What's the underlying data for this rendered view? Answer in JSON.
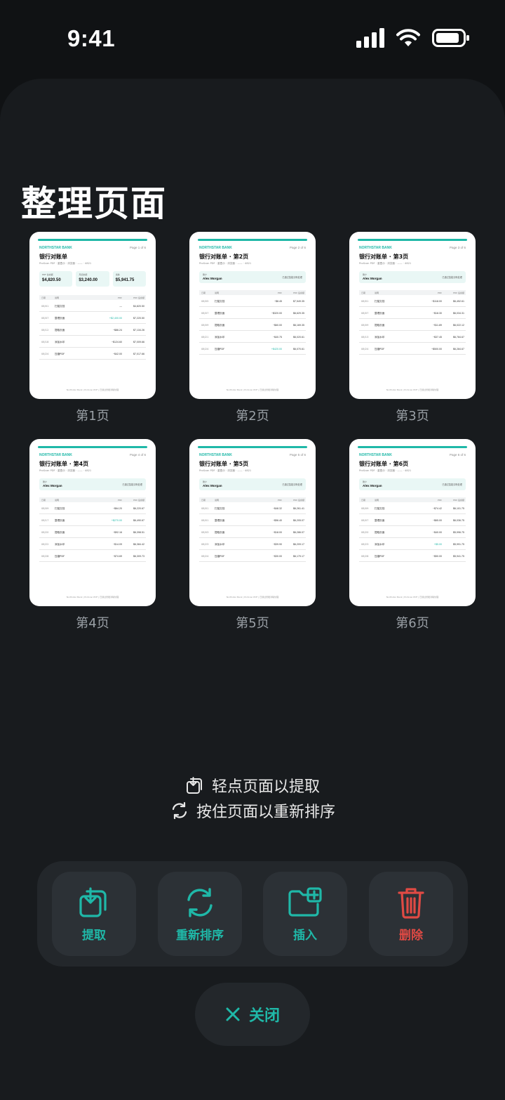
{
  "status": {
    "time": "9:41"
  },
  "title": "整理页面",
  "doc_common": {
    "bank": "NORTHSTAR BANK",
    "subtitle": "ProScan PDF · 重叠示 · 浏览器 · —— · 4821",
    "account_label": "账户",
    "account_name": "Alex Morgan",
    "account_note": "已通过智能清晰处理",
    "head_date": "日期",
    "head_desc": "说明",
    "head_amt": "PDF",
    "head_bal": "PDF 后余额",
    "footer": "Northstar Bank | ProScan PDF | 已通过智能清晰处理",
    "stat_labels": [
      "PDF 总余额",
      "月初余额",
      "当前"
    ]
  },
  "pages": [
    {
      "label": "第1页",
      "pageof": "Page 1 of 6",
      "doc_title": "银行对账单",
      "stats": [
        "$4,820.50",
        "$3,240.00",
        "$5,941.75"
      ],
      "rows": [
        {
          "d": "08/01",
          "t": "扫描文档",
          "a": "—",
          "b": "$4,820.50",
          "pos": false
        },
        {
          "d": "08/07",
          "t": "整理页面",
          "a": "+$2,400.00",
          "b": "$7,220.50",
          "pos": true
        },
        {
          "d": "08/12",
          "t": "提取页面",
          "a": "−$86.24",
          "b": "$7,134.26",
          "pos": false
        },
        {
          "d": "08/18",
          "t": "添加水印",
          "a": "−$124.60",
          "b": "$7,009.66",
          "pos": false
        },
        {
          "d": "08/24",
          "t": "压缩PDF",
          "a": "−$42.00",
          "b": "$7,017.66",
          "pos": false
        }
      ]
    },
    {
      "label": "第2页",
      "pageof": "Page 2 of 6",
      "doc_title": "银行对账单 · 第2页",
      "rows": [
        {
          "d": "08/05",
          "t": "扫描文档",
          "a": "−$8.45",
          "b": "$7,549.35",
          "pos": false
        },
        {
          "d": "08/07",
          "t": "整理页面",
          "a": "−$320.00",
          "b": "$6,629.35",
          "pos": false
        },
        {
          "d": "08/09",
          "t": "提取页面",
          "a": "−$60.00",
          "b": "$6,169.35",
          "pos": false
        },
        {
          "d": "08/21",
          "t": "添加水印",
          "a": "−$40.75",
          "b": "$6,020.61",
          "pos": false
        },
        {
          "d": "08/24",
          "t": "压缩PDF",
          "a": "+$420.00",
          "b": "$6,070.61",
          "pos": true
        }
      ]
    },
    {
      "label": "第3页",
      "pageof": "Page 3 of 6",
      "doc_title": "银行对账单 · 第3页",
      "rows": [
        {
          "d": "08/01",
          "t": "扫描文档",
          "a": "−$118.00",
          "b": "$6,452.61",
          "pos": false
        },
        {
          "d": "08/07",
          "t": "整理页面",
          "a": "−$18.30",
          "b": "$6,034.31",
          "pos": false
        },
        {
          "d": "08/09",
          "t": "提取页面",
          "a": "−$11.89",
          "b": "$6,022.12",
          "pos": false
        },
        {
          "d": "08/13",
          "t": "添加水印",
          "a": "−$37.45",
          "b": "$6,784.67",
          "pos": false
        },
        {
          "d": "08/24",
          "t": "压缩PDF",
          "a": "−$500.00",
          "b": "$6,284.67",
          "pos": false
        }
      ]
    },
    {
      "label": "第4页",
      "pageof": "Page 4 of 6",
      "doc_title": "银行对账单 · 第4页",
      "rows": [
        {
          "d": "08/09",
          "t": "扫描文档",
          "a": "−$64.20",
          "b": "$6,220.67",
          "pos": false
        },
        {
          "d": "08/17",
          "t": "整理页面",
          "a": "+$270.00",
          "b": "$6,490.67",
          "pos": true
        },
        {
          "d": "08/20",
          "t": "提取页面",
          "a": "−$92.16",
          "b": "$6,398.51",
          "pos": false
        },
        {
          "d": "08/22",
          "t": "添加水印",
          "a": "−$14.09",
          "b": "$6,384.42",
          "pos": false
        },
        {
          "d": "08/28",
          "t": "压缩PDF",
          "a": "−$74.69",
          "b": "$6,309.73",
          "pos": false
        }
      ]
    },
    {
      "label": "第5页",
      "pageof": "Page 5 of 6",
      "doc_title": "银行对账单 · 第5页",
      "rows": [
        {
          "d": "08/01",
          "t": "扫描文档",
          "a": "−$48.32",
          "b": "$6,261.41",
          "pos": false
        },
        {
          "d": "08/01",
          "t": "整理页面",
          "a": "−$56.40",
          "b": "$6,205.07",
          "pos": false
        },
        {
          "d": "08/03",
          "t": "提取页面",
          "a": "−$18.00",
          "b": "$6,286.07",
          "pos": false
        },
        {
          "d": "08/23",
          "t": "添加水印",
          "a": "−$39.90",
          "b": "$6,209.17",
          "pos": false
        },
        {
          "d": "08/24",
          "t": "压缩PDF",
          "a": "−$30.00",
          "b": "$6,179.17",
          "pos": false
        }
      ]
    },
    {
      "label": "第6页",
      "pageof": "Page 6 of 6",
      "doc_title": "银行对账单 · 第6页",
      "rows": [
        {
          "d": "08/09",
          "t": "扫描文档",
          "a": "−$74.42",
          "b": "$6,101.75",
          "pos": false
        },
        {
          "d": "08/07",
          "t": "整理页面",
          "a": "−$65.00",
          "b": "$6,036.75",
          "pos": false
        },
        {
          "d": "08/20",
          "t": "提取页面",
          "a": "−$40.00",
          "b": "$5,996.75",
          "pos": false
        },
        {
          "d": "08/23",
          "t": "添加水印",
          "a": "+$5.00",
          "b": "$5,991.75",
          "pos": true
        },
        {
          "d": "08/28",
          "t": "压缩PDF",
          "a": "−$50.00",
          "b": "$5,941.75",
          "pos": false
        }
      ]
    }
  ],
  "hints": {
    "tap": "轻点页面以提取",
    "hold": "按住页面以重新排序"
  },
  "toolbar": {
    "extract": "提取",
    "reorder": "重新排序",
    "insert": "插入",
    "delete": "删除"
  },
  "close": "关闭",
  "colors": {
    "accent": "#1fb8a8",
    "danger": "#e04a44",
    "sheet": "#181b1e"
  }
}
